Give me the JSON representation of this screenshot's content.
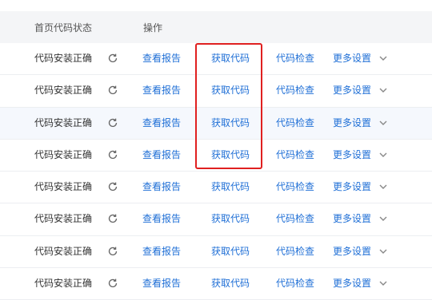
{
  "header": {
    "status_col": "首页代码状态",
    "ops_col": "操作"
  },
  "accent_color": "#1f6fd6",
  "highlight_color": "#e02020",
  "rows": [
    {
      "status": "代码安装正确",
      "view_report": "查看报告",
      "get_code": "获取代码",
      "code_check": "代码检查",
      "more_settings": "更多设置",
      "icon": "refresh-icon"
    },
    {
      "status": "代码安装正确",
      "view_report": "查看报告",
      "get_code": "获取代码",
      "code_check": "代码检查",
      "more_settings": "更多设置",
      "icon": "refresh-icon"
    },
    {
      "status": "代码安装正确",
      "view_report": "查看报告",
      "get_code": "获取代码",
      "code_check": "代码检查",
      "more_settings": "更多设置",
      "icon": "refresh-icon"
    },
    {
      "status": "代码安装正确",
      "view_report": "查看报告",
      "get_code": "获取代码",
      "code_check": "代码检查",
      "more_settings": "更多设置",
      "icon": "refresh-icon"
    },
    {
      "status": "代码安装正确",
      "view_report": "查看报告",
      "get_code": "获取代码",
      "code_check": "代码检查",
      "more_settings": "更多设置",
      "icon": "refresh-icon"
    },
    {
      "status": "代码安装正确",
      "view_report": "查看报告",
      "get_code": "获取代码",
      "code_check": "代码检查",
      "more_settings": "更多设置",
      "icon": "refresh-icon"
    },
    {
      "status": "代码安装正确",
      "view_report": "查看报告",
      "get_code": "获取代码",
      "code_check": "代码检查",
      "more_settings": "更多设置",
      "icon": "refresh-icon"
    },
    {
      "status": "代码安装正确",
      "view_report": "查看报告",
      "get_code": "获取代码",
      "code_check": "代码检查",
      "more_settings": "更多设置",
      "icon": "refresh-icon"
    }
  ]
}
